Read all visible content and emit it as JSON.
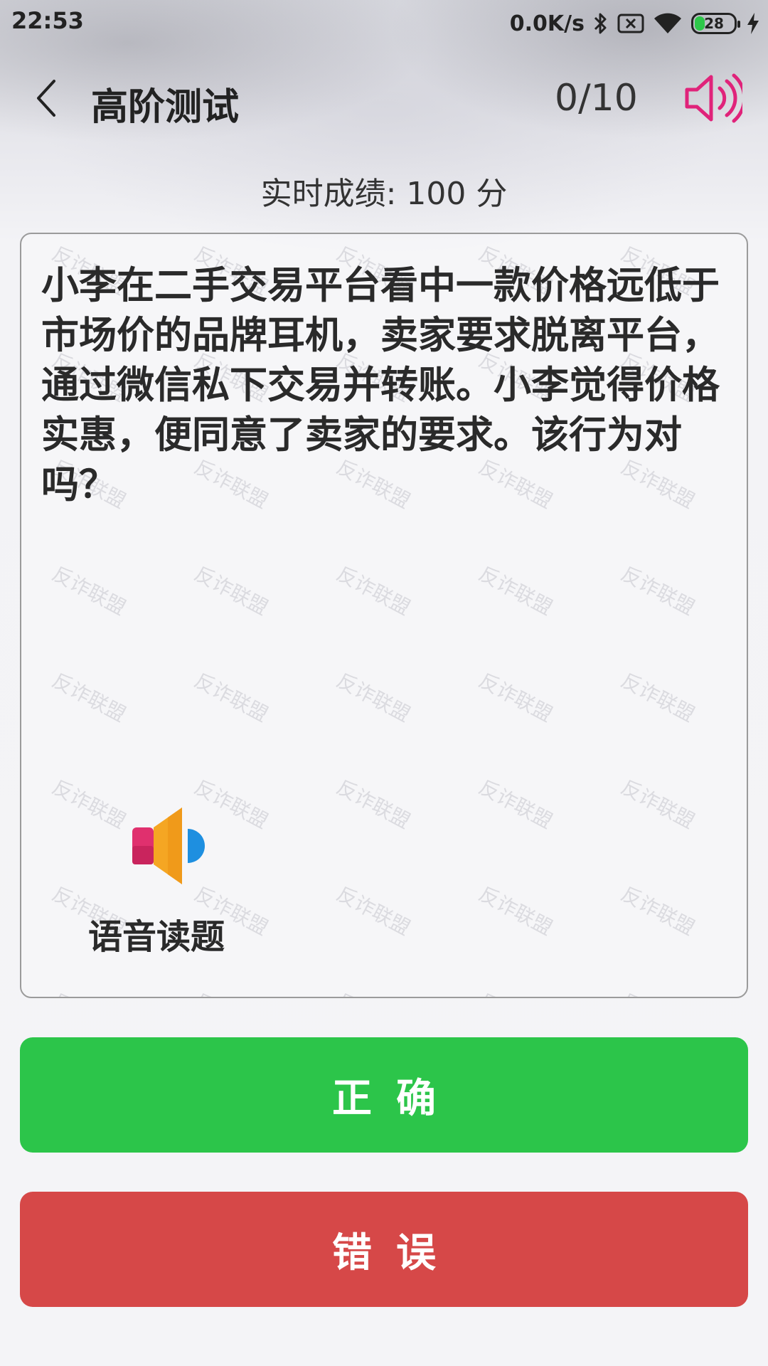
{
  "status_bar": {
    "time": "22:53",
    "net_speed": "0.0K/s",
    "battery_level": "28",
    "icons": [
      "bluetooth-icon",
      "sim-none-icon",
      "wifi-icon",
      "battery-icon",
      "charging-icon"
    ]
  },
  "header": {
    "title": "高阶测试",
    "progress": "0/10",
    "back_icon": "chevron-left-icon",
    "sound_icon": "speaker-icon"
  },
  "score": {
    "text": "实时成绩: 100 分"
  },
  "question": {
    "text": "小李在二手交易平台看中一款价格远低于市场价的品牌耳机，卖家要求脱离平台，通过微信私下交易并转账。小李觉得价格实惠，便同意了卖家的要求。该行为对吗？",
    "watermark": "反诈联盟",
    "voice_label": "语音读题"
  },
  "answers": {
    "correct_label": "正确",
    "wrong_label": "错误"
  },
  "colors": {
    "correct": "#2cc54a",
    "wrong": "#d64848",
    "sound_icon": "#e0237a",
    "battery_fill": "#2ec74a"
  }
}
